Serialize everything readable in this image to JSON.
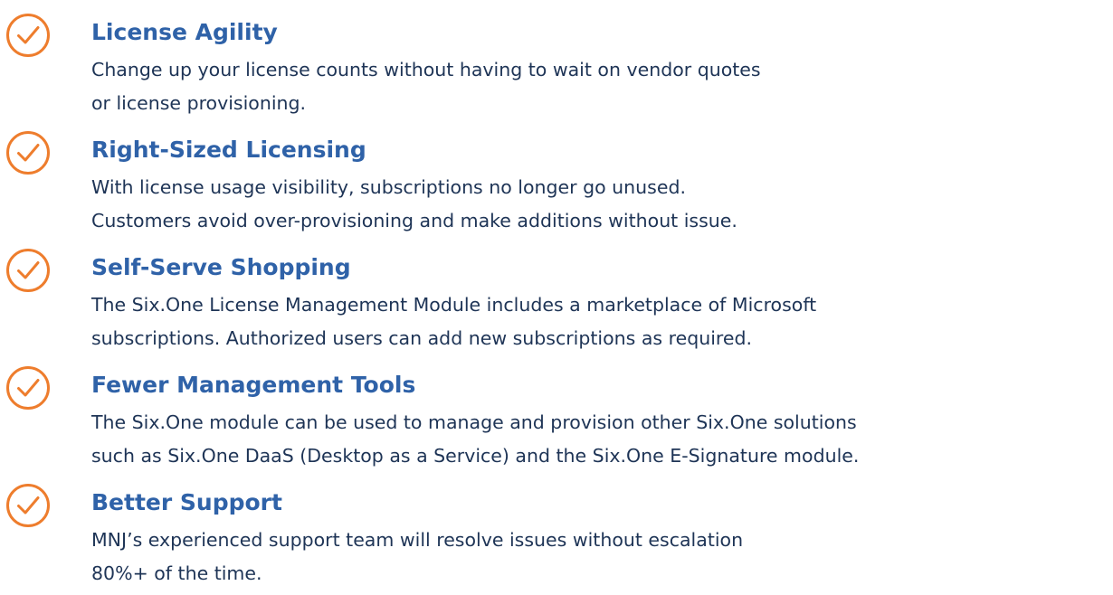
{
  "colors": {
    "accent_orange": "#ee7d2d",
    "title_blue": "#2f62a8",
    "body_navy": "#1e3456"
  },
  "features": [
    {
      "icon": "check-circle-icon",
      "title": "License Agility",
      "description_lines": [
        "Change up your license counts without having to wait on vendor quotes",
        "or license provisioning."
      ]
    },
    {
      "icon": "check-circle-icon",
      "title": "Right-Sized Licensing",
      "description_lines": [
        "With license usage visibility, subscriptions no longer go unused.",
        "Customers avoid over-provisioning and make additions without issue."
      ]
    },
    {
      "icon": "check-circle-icon",
      "title": "Self-Serve Shopping",
      "description_lines": [
        "The Six.One License Management Module includes a marketplace of Microsoft",
        "subscriptions. Authorized users can add new subscriptions as required."
      ]
    },
    {
      "icon": "check-circle-icon",
      "title": "Fewer Management Tools",
      "description_lines": [
        "The Six.One module can be used to manage and provision other Six.One solutions",
        "such as Six.One DaaS (Desktop as a Service) and the Six.One E-Signature module."
      ]
    },
    {
      "icon": "check-circle-icon",
      "title": "Better Support",
      "description_lines": [
        "MNJ’s experienced support team will resolve issues without escalation",
        "80%+ of the time."
      ]
    }
  ]
}
